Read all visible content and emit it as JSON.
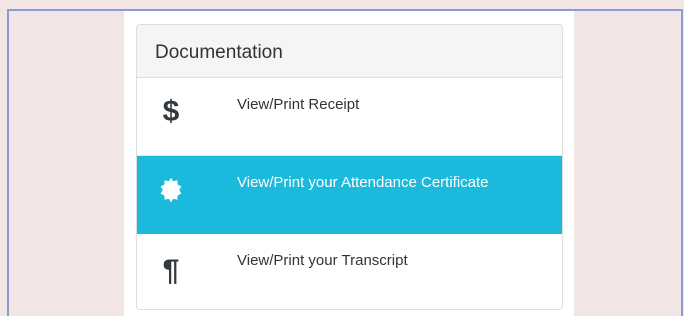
{
  "panel": {
    "heading": "Documentation",
    "items": [
      {
        "icon": "dollar-icon",
        "symbol": "$",
        "label": "View/Print Receipt",
        "active": false
      },
      {
        "icon": "certificate-badge-icon",
        "label": "View/Print your Attendance Certificate",
        "active": true
      },
      {
        "icon": "pilcrow-icon",
        "symbol": "¶",
        "label": "View/Print your Transcript",
        "active": false
      }
    ]
  },
  "colors": {
    "page_background": "#f1e6e4",
    "frame_border": "#8b9bd6",
    "active_item": "#1bb9dc",
    "heading_background": "#f5f5f5",
    "icon": "#333a3f"
  }
}
